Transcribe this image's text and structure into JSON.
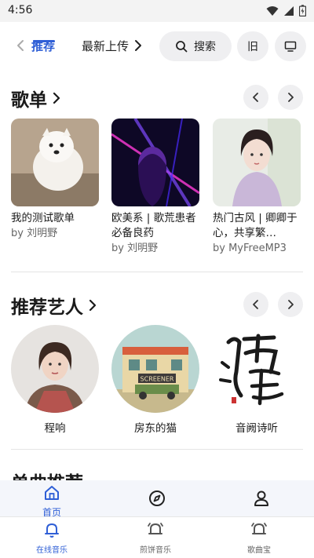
{
  "status_bar": {
    "time": "4:56"
  },
  "top_tabs": {
    "recommend": "推荐",
    "latest": "最新上传",
    "search_label": "搜索",
    "old_label": "旧"
  },
  "playlists": {
    "title": "歌单",
    "items": [
      {
        "title": "我的测试歌单",
        "by": "by 刘明野"
      },
      {
        "title": "欧美系 | 歌荒患者必备良药",
        "by": "by 刘明野"
      },
      {
        "title": "热门古风 | 卿卿于心，共享繁…",
        "by": "by MyFreeMP3"
      }
    ]
  },
  "artists": {
    "title": "推荐艺人",
    "items": [
      {
        "name": "程响"
      },
      {
        "name": "房东的猫",
        "sign": "SCREENER"
      },
      {
        "name": "音阙诗听"
      }
    ]
  },
  "songs": {
    "title": "单曲推荐"
  },
  "inner_nav": {
    "home": "首页"
  },
  "outer_nav": {
    "online": "在线音乐",
    "qianqian": "煎饼音乐",
    "lyrics": "歌曲宝"
  },
  "colors": {
    "accent": "#2f5fd6",
    "chip_bg": "#efeff1"
  }
}
